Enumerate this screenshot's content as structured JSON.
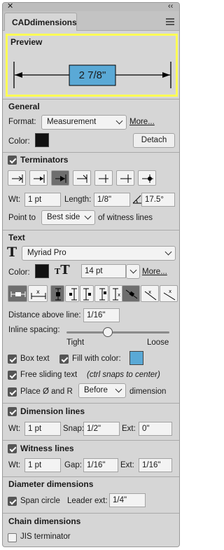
{
  "app": {
    "tab_label": "CADdimensions"
  },
  "colors": {
    "highlight_border": "#ffff55",
    "box_fill": "#5aa9d6",
    "text_color_swatch": "#111111",
    "fill_swatch": "#5aa9d6",
    "general_color_swatch": "#111111"
  },
  "preview": {
    "title": "Preview",
    "dimension_value": "2 7/8\""
  },
  "general": {
    "title": "General",
    "format_label": "Format:",
    "format_value": "Measurement",
    "more_label": "More...",
    "color_label": "Color:",
    "detach_label": "Detach"
  },
  "terminators": {
    "title": "Terminators",
    "wt_label": "Wt:",
    "wt_value": "1 pt",
    "length_label": "Length:",
    "length_value": "1/8\"",
    "angle_value": "17.5°",
    "point_to_label": "Point to",
    "point_to_value": "Best side",
    "witness_suffix": "of witness lines",
    "icons": [
      "arrow-right-bar-icon",
      "arrow-right-bar-open-icon",
      "arrow-right-bar-filled-icon",
      "tick-right-icon",
      "tick-left-icon",
      "tick-both-icon",
      "dot-terminator-icon"
    ]
  },
  "text": {
    "title": "Text",
    "font_value": "Myriad Pro",
    "color_label": "Color:",
    "size_value": "14 pt",
    "more_label": "More...",
    "distance_label": "Distance above line:",
    "distance_value": "1/16\"",
    "inline_spacing_label": "Inline spacing:",
    "slider_left": "Tight",
    "slider_right": "Loose",
    "slider_value": 0.4,
    "box_text_label": "Box text",
    "fill_label": "Fill with color:",
    "free_sliding_label": "Free sliding text",
    "free_sliding_hint": "(ctrl snaps to center)",
    "place_label": "Place Ø and R",
    "place_value": "Before",
    "place_suffix": "dimension"
  },
  "dimension_lines": {
    "title": "Dimension lines",
    "wt_label": "Wt:",
    "wt_value": "1 pt",
    "snap_label": "Snap:",
    "snap_value": "1/2\"",
    "ext_label": "Ext:",
    "ext_value": "0\""
  },
  "witness_lines": {
    "title": "Witness lines",
    "wt_label": "Wt:",
    "wt_value": "1 pt",
    "gap_label": "Gap:",
    "gap_value": "1/16\"",
    "ext_label": "Ext:",
    "ext_value": "1/16\""
  },
  "diameter": {
    "title": "Diameter dimensions",
    "span_circle_label": "Span circle",
    "leader_ext_label": "Leader ext:",
    "leader_ext_value": "1/4\""
  },
  "chain": {
    "title": "Chain dimensions",
    "jis_label": "JIS terminator"
  }
}
